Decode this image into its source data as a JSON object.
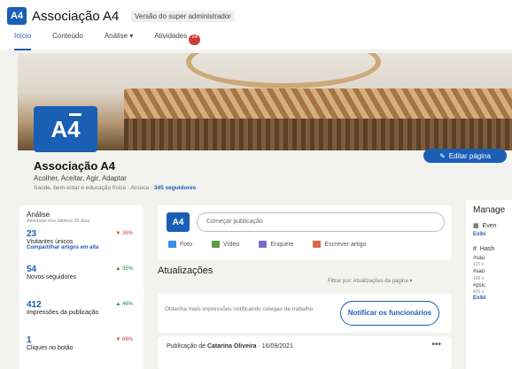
{
  "app": {
    "title": "Associação A4",
    "admin_view": "Versão do super administrador",
    "logo_text": "A4"
  },
  "nav": {
    "tabs": [
      {
        "label": "Início"
      },
      {
        "label": "Conteúdo"
      },
      {
        "label": "Análise"
      },
      {
        "label": "Atividades",
        "badge": "14"
      }
    ]
  },
  "profile": {
    "name": "Associação A4",
    "tagline": "Acolher, Aceitar, Agir, Adaptar",
    "meta": "Saúde, bem-estar e educação física · Arouca ·",
    "followers": "345 seguidores",
    "edit_label": "Editar página"
  },
  "analytics": {
    "title": "Análise",
    "subtitle": "Atividade nos últimos 30 dias",
    "stats": [
      {
        "value": "23",
        "label": "Visitantes únicos",
        "change": "▼ 36%",
        "dir": "down"
      },
      {
        "value": "54",
        "label": "Novos seguidores",
        "change": "▲ 35%",
        "dir": "up"
      },
      {
        "value": "412",
        "label": "Impressões da publicação",
        "change": "▲ 46%",
        "dir": "up"
      },
      {
        "value": "1",
        "label": "Cliques no botão",
        "change": "▼ 66%",
        "dir": "down"
      }
    ],
    "share_link": "Compartilhar artigos em alta"
  },
  "composer": {
    "placeholder": "Começar publicação",
    "actions": [
      {
        "label": "Foto",
        "icon": "photo-icon",
        "color": "#378fe9"
      },
      {
        "label": "Vídeo",
        "icon": "video-icon",
        "color": "#5f9b41"
      },
      {
        "label": "Enquete",
        "icon": "poll-icon",
        "color": "#7a6ccf"
      },
      {
        "label": "Escrever artigo",
        "icon": "article-icon",
        "color": "#e06847"
      }
    ]
  },
  "updates": {
    "title": "Atualizações",
    "filter_label": "Filtrar por: Atualizações da página",
    "notify_text": "Obtenha mais impressões notificando colegas de trabalho.",
    "notify_button": "Notificar os funcionários",
    "post_prefix": "Publicação de",
    "post_author": "Catarina Oliveira",
    "post_date": "· 16/09/2021"
  },
  "manage": {
    "title": "Manage",
    "events": "Even",
    "show1": "Exibi",
    "hashtag": "Hash",
    "tags": [
      "#saú",
      "#saú",
      "#psic"
    ],
    "tag_counts": [
      "115 s",
      "143 s",
      "425 s"
    ],
    "show2": "Exibi"
  },
  "colors": {
    "brand": "#1a5fb4",
    "up": "#1b8a3a",
    "down": "#d13b3b"
  }
}
